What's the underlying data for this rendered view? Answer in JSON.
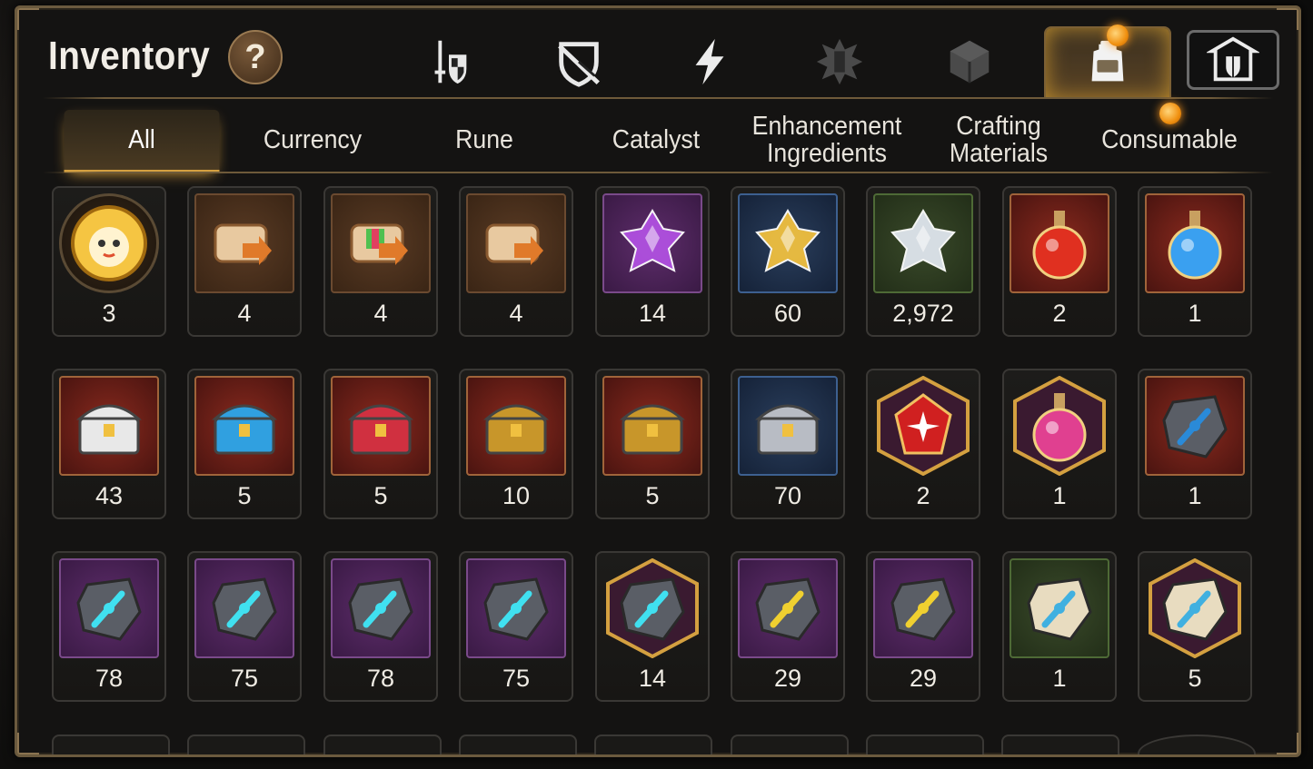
{
  "header": {
    "title": "Inventory",
    "help_label": "?"
  },
  "top_tabs": [
    {
      "icon": "hero-gear-icon"
    },
    {
      "icon": "artifact-shield-icon"
    },
    {
      "icon": "lightning-icon"
    },
    {
      "icon": "emblem-icon"
    },
    {
      "icon": "cube-icon"
    },
    {
      "icon": "backpack-icon",
      "active": true,
      "badge": true
    },
    {
      "icon": "guild-hall-icon"
    }
  ],
  "categories": [
    {
      "label": "All",
      "active": true
    },
    {
      "label": "Currency"
    },
    {
      "label": "Rune"
    },
    {
      "label": "Catalyst"
    },
    {
      "label": "Enhancement Ingredients"
    },
    {
      "label": "Crafting Materials"
    },
    {
      "label": "Consumable",
      "badge": true
    }
  ],
  "items": [
    {
      "count": "3",
      "frame": "round",
      "icon": "mascot-coin-icon",
      "color": "#f5c542"
    },
    {
      "count": "4",
      "frame": "brown",
      "icon": "upgrade-scroll-icon",
      "color": "#e07a2a"
    },
    {
      "count": "4",
      "frame": "brown",
      "icon": "rainbow-upgrade-scroll-icon",
      "color": "#e07a2a"
    },
    {
      "count": "4",
      "frame": "brown",
      "icon": "upgrade-scroll-icon",
      "color": "#e07a2a"
    },
    {
      "count": "14",
      "frame": "purple",
      "icon": "purple-crystal-icon",
      "color": "#b050e0"
    },
    {
      "count": "60",
      "frame": "blue",
      "icon": "gold-crystal-icon",
      "color": "#f0c040"
    },
    {
      "count": "2,972",
      "frame": "green",
      "icon": "silver-crystal-icon",
      "color": "#dfe6ee"
    },
    {
      "count": "2",
      "frame": "red",
      "icon": "red-potion-icon",
      "color": "#e03020"
    },
    {
      "count": "1",
      "frame": "red",
      "icon": "star-potion-icon",
      "color": "#3aa0f0"
    },
    {
      "count": "43",
      "frame": "red",
      "icon": "white-chest-icon",
      "color": "#e8e8e8"
    },
    {
      "count": "5",
      "frame": "red",
      "icon": "blue-chest-icon",
      "color": "#30a0e0"
    },
    {
      "count": "5",
      "frame": "red",
      "icon": "red-chest-icon",
      "color": "#d03040"
    },
    {
      "count": "10",
      "frame": "red",
      "icon": "gold-trim-chest-icon",
      "color": "#c8962a"
    },
    {
      "count": "5",
      "frame": "red",
      "icon": "gold-trim-chest-icon",
      "color": "#c8962a"
    },
    {
      "count": "70",
      "frame": "blue",
      "icon": "silver-chest-icon",
      "color": "#b8bcc4"
    },
    {
      "count": "2",
      "frame": "hex",
      "icon": "red-gem-icon",
      "color": "#d02020"
    },
    {
      "count": "1",
      "frame": "hex",
      "icon": "pink-potion-icon",
      "color": "#e04090"
    },
    {
      "count": "1",
      "frame": "red",
      "icon": "hammer-rune-icon",
      "color": "#2a8ad8"
    },
    {
      "count": "78",
      "frame": "purple",
      "icon": "sword-rune-icon",
      "color": "#40e0f0"
    },
    {
      "count": "75",
      "frame": "purple",
      "icon": "helmet-rune-icon",
      "color": "#40e0f0"
    },
    {
      "count": "78",
      "frame": "purple",
      "icon": "armor-rune-icon",
      "color": "#40e0f0"
    },
    {
      "count": "75",
      "frame": "purple",
      "icon": "boot-rune-icon",
      "color": "#40e0f0"
    },
    {
      "count": "14",
      "frame": "hex",
      "icon": "star-rune-icon",
      "color": "#40e0f0"
    },
    {
      "count": "29",
      "frame": "purple",
      "icon": "hammer-gold-rune-icon",
      "color": "#f0d030"
    },
    {
      "count": "29",
      "frame": "purple",
      "icon": "slash-gold-rune-icon",
      "color": "#f0d030"
    },
    {
      "count": "1",
      "frame": "green",
      "icon": "stone-sword-rune-icon",
      "color": "#40b0e0"
    },
    {
      "count": "5",
      "frame": "hex",
      "icon": "stone-star-rune-icon",
      "color": "#40b0e0"
    }
  ]
}
